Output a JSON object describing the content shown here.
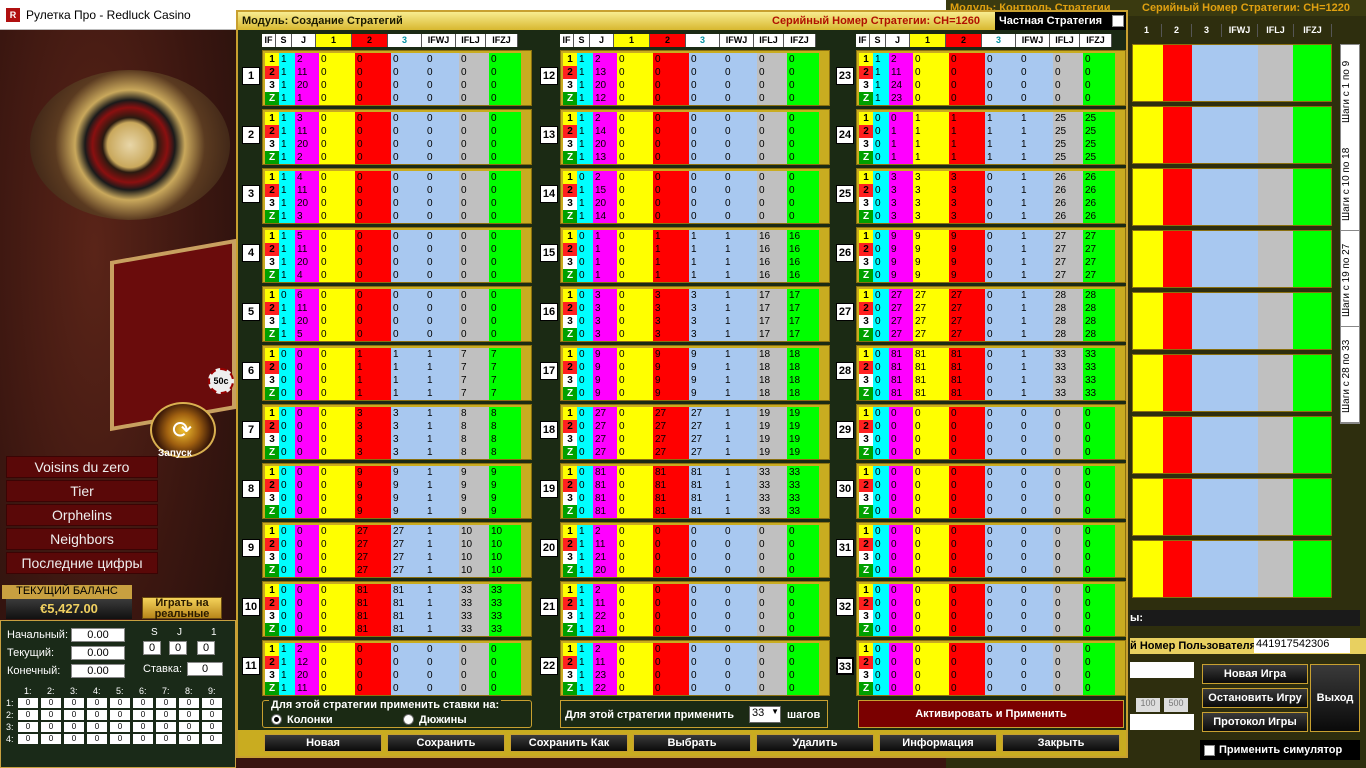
{
  "window": {
    "title": "Рулетка Про - Redluck Casino"
  },
  "casino": {
    "spin_label": "Запуск",
    "chip_label": "50c",
    "menu": [
      "Voisins du zero",
      "Tier",
      "Orphelins",
      "Neighbors",
      "Последние цифры"
    ],
    "balance_label": "ТЕКУЩИЙ БАЛАНС",
    "balance_value": "€5,427.00",
    "real_button": "Играть на реальные",
    "initial_label": "Начальный:",
    "initial_value": "0.00",
    "current_label": "Текущий:",
    "current_value": "0.00",
    "final_label": "Конечный:",
    "final_value": "0.00",
    "sj_headers": [
      "S",
      "J",
      "1"
    ],
    "sj_values": [
      "0",
      "0",
      "0"
    ],
    "stake_label": "Ставка:",
    "stake_value": "0",
    "grid_cols": [
      "1:",
      "2:",
      "3:",
      "4:",
      "5:",
      "6:",
      "7:",
      "8:",
      "9:"
    ],
    "grid_rows": [
      "1:",
      "2:",
      "3:",
      "4:"
    ],
    "grid_value": "0"
  },
  "right": {
    "header_left": "Модуль: Контроль Стратегии",
    "serial": "Серийный Номер Стратегии: СН=1220",
    "cols": [
      "1",
      "2",
      "3",
      "IFWJ",
      "IFLJ",
      "IFZJ"
    ],
    "tabs": [
      "Шаги с 1 по 9",
      "Шаги с 10 по 18",
      "Шаги с 19 по 27",
      "Шаги с 28 по 33"
    ],
    "user_serial_label": "й Номер Пользователя:",
    "user_serial_value": "441917542306",
    "buttons": {
      "new_game": "Новая Игра",
      "stop_game": "Остановить Игру",
      "protocol": "Протокол Игры",
      "exit": "Выход"
    },
    "amounts": [
      "100",
      "500"
    ],
    "tail_label": "ы:",
    "simulator": "Применить симулятор"
  },
  "dialog": {
    "title": "Модуль: Создание Стратегий",
    "serial": "Серийный Номер Стратегии: СН=1260",
    "private": "Частная Стратегия",
    "columns": [
      "IF",
      "S",
      "J",
      "1",
      "2",
      "3",
      "IFWJ",
      "IFLJ",
      "IFZJ"
    ],
    "apply_stakes_title": "Для этой стратегии применить ставки на:",
    "radio_columns": "Колонки",
    "radio_dozens": "Дюжины",
    "apply_label": "Для этой стратегии применить",
    "steps_value": "33",
    "steps_label": "шагов",
    "activate_button": "Активировать и Применить",
    "buttons": [
      "Новая",
      "Сохранить",
      "Сохранить Как",
      "Выбрать",
      "Удалить",
      "Информация",
      "Закрыть"
    ]
  },
  "steps": [
    {
      "n": "1",
      "s": [
        "1",
        "1",
        "1",
        "1"
      ],
      "j": [
        "2",
        "11",
        "20",
        "1"
      ],
      "v1": "0",
      "v2": "0",
      "v3": "0",
      "wj": "0",
      "lj": "0",
      "zj": "0"
    },
    {
      "n": "2",
      "s": [
        "1",
        "1",
        "1",
        "1"
      ],
      "j": [
        "3",
        "11",
        "20",
        "2"
      ],
      "v1": "0",
      "v2": "0",
      "v3": "0",
      "wj": "0",
      "lj": "0",
      "zj": "0"
    },
    {
      "n": "3",
      "s": [
        "1",
        "1",
        "1",
        "1"
      ],
      "j": [
        "4",
        "11",
        "20",
        "3"
      ],
      "v1": "0",
      "v2": "0",
      "v3": "0",
      "wj": "0",
      "lj": "0",
      "zj": "0"
    },
    {
      "n": "4",
      "s": [
        "1",
        "1",
        "1",
        "1"
      ],
      "j": [
        "5",
        "11",
        "20",
        "4"
      ],
      "v1": "0",
      "v2": "0",
      "v3": "0",
      "wj": "0",
      "lj": "0",
      "zj": "0"
    },
    {
      "n": "5",
      "s": [
        "0",
        "1",
        "1",
        "1"
      ],
      "j": [
        "6",
        "11",
        "20",
        "5"
      ],
      "v1": "0",
      "v2": "0",
      "v3": "0",
      "wj": "0",
      "lj": "0",
      "zj": "0"
    },
    {
      "n": "6",
      "s": [
        "0",
        "0",
        "0",
        "0"
      ],
      "j": [
        "0",
        "0",
        "0",
        "0"
      ],
      "v1": "0",
      "v2": "1",
      "v3": "1",
      "wj": "1",
      "lj": "7",
      "zj": "7"
    },
    {
      "n": "7",
      "s": [
        "0",
        "0",
        "0",
        "0"
      ],
      "j": [
        "0",
        "0",
        "0",
        "0"
      ],
      "v1": "0",
      "v2": "3",
      "v3": "3",
      "wj": "1",
      "lj": "8",
      "zj": "8"
    },
    {
      "n": "8",
      "s": [
        "0",
        "0",
        "0",
        "0"
      ],
      "j": [
        "0",
        "0",
        "0",
        "0"
      ],
      "v1": "0",
      "v2": "9",
      "v3": "9",
      "wj": "1",
      "lj": "9",
      "zj": "9"
    },
    {
      "n": "9",
      "s": [
        "0",
        "0",
        "0",
        "0"
      ],
      "j": [
        "0",
        "0",
        "0",
        "0"
      ],
      "v1": "0",
      "v2": "27",
      "v3": "27",
      "wj": "1",
      "lj": "10",
      "zj": "10"
    },
    {
      "n": "10",
      "s": [
        "0",
        "0",
        "0",
        "0"
      ],
      "j": [
        "0",
        "0",
        "0",
        "0"
      ],
      "v1": "0",
      "v2": "81",
      "v3": "81",
      "wj": "1",
      "lj": "33",
      "zj": "33"
    },
    {
      "n": "11",
      "s": [
        "1",
        "1",
        "1",
        "1"
      ],
      "j": [
        "2",
        "12",
        "20",
        "11"
      ],
      "v1": "0",
      "v2": "0",
      "v3": "0",
      "wj": "0",
      "lj": "0",
      "zj": "0"
    },
    {
      "n": "12",
      "s": [
        "1",
        "1",
        "1",
        "1"
      ],
      "j": [
        "2",
        "13",
        "20",
        "12"
      ],
      "v1": "0",
      "v2": "0",
      "v3": "0",
      "wj": "0",
      "lj": "0",
      "zj": "0"
    },
    {
      "n": "13",
      "s": [
        "1",
        "1",
        "1",
        "1"
      ],
      "j": [
        "2",
        "14",
        "20",
        "13"
      ],
      "v1": "0",
      "v2": "0",
      "v3": "0",
      "wj": "0",
      "lj": "0",
      "zj": "0"
    },
    {
      "n": "14",
      "s": [
        "0",
        "1",
        "1",
        "1"
      ],
      "j": [
        "2",
        "15",
        "20",
        "14"
      ],
      "v1": "0",
      "v2": "0",
      "v3": "0",
      "wj": "0",
      "lj": "0",
      "zj": "0"
    },
    {
      "n": "15",
      "s": [
        "0",
        "0",
        "0",
        "0"
      ],
      "j": [
        "1",
        "1",
        "1",
        "1"
      ],
      "v1": "0",
      "v2": "1",
      "v3": "1",
      "wj": "1",
      "lj": "16",
      "zj": "16"
    },
    {
      "n": "16",
      "s": [
        "0",
        "0",
        "0",
        "0"
      ],
      "j": [
        "3",
        "3",
        "3",
        "3"
      ],
      "v1": "0",
      "v2": "3",
      "v3": "3",
      "wj": "1",
      "lj": "17",
      "zj": "17"
    },
    {
      "n": "17",
      "s": [
        "0",
        "0",
        "0",
        "0"
      ],
      "j": [
        "9",
        "9",
        "9",
        "9"
      ],
      "v1": "0",
      "v2": "9",
      "v3": "9",
      "wj": "1",
      "lj": "18",
      "zj": "18"
    },
    {
      "n": "18",
      "s": [
        "0",
        "0",
        "0",
        "0"
      ],
      "j": [
        "27",
        "27",
        "27",
        "27"
      ],
      "v1": "0",
      "v2": "27",
      "v3": "27",
      "wj": "1",
      "lj": "19",
      "zj": "19"
    },
    {
      "n": "19",
      "s": [
        "0",
        "0",
        "0",
        "0"
      ],
      "j": [
        "81",
        "81",
        "81",
        "81"
      ],
      "v1": "0",
      "v2": "81",
      "v3": "81",
      "wj": "1",
      "lj": "33",
      "zj": "33"
    },
    {
      "n": "20",
      "s": [
        "1",
        "1",
        "1",
        "1"
      ],
      "j": [
        "2",
        "11",
        "21",
        "20"
      ],
      "v1": "0",
      "v2": "0",
      "v3": "0",
      "wj": "0",
      "lj": "0",
      "zj": "0"
    },
    {
      "n": "21",
      "s": [
        "1",
        "1",
        "1",
        "1"
      ],
      "j": [
        "2",
        "11",
        "22",
        "21"
      ],
      "v1": "0",
      "v2": "0",
      "v3": "0",
      "wj": "0",
      "lj": "0",
      "zj": "0"
    },
    {
      "n": "22",
      "s": [
        "1",
        "1",
        "1",
        "1"
      ],
      "j": [
        "2",
        "11",
        "23",
        "22"
      ],
      "v1": "0",
      "v2": "0",
      "v3": "0",
      "wj": "0",
      "lj": "0",
      "zj": "0"
    },
    {
      "n": "23",
      "s": [
        "1",
        "1",
        "1",
        "1"
      ],
      "j": [
        "2",
        "11",
        "24",
        "23"
      ],
      "v1": "0",
      "v2": "0",
      "v3": "0",
      "wj": "0",
      "lj": "0",
      "zj": "0"
    },
    {
      "n": "24",
      "s": [
        "0",
        "0",
        "0",
        "0"
      ],
      "j": [
        "0",
        "1",
        "1",
        "1"
      ],
      "v1": "1",
      "v2": "1",
      "v3": "1",
      "wj": "1",
      "lj": "25",
      "zj": "25"
    },
    {
      "n": "25",
      "s": [
        "0",
        "0",
        "0",
        "0"
      ],
      "j": [
        "3",
        "3",
        "3",
        "3"
      ],
      "v1": "3",
      "v2": "3",
      "v3": "0",
      "wj": "1",
      "lj": "26",
      "zj": "26"
    },
    {
      "n": "26",
      "s": [
        "0",
        "0",
        "0",
        "0"
      ],
      "j": [
        "9",
        "9",
        "9",
        "9"
      ],
      "v1": "9",
      "v2": "9",
      "v3": "0",
      "wj": "1",
      "lj": "27",
      "zj": "27"
    },
    {
      "n": "27",
      "s": [
        "0",
        "0",
        "0",
        "0"
      ],
      "j": [
        "27",
        "27",
        "27",
        "27"
      ],
      "v1": "27",
      "v2": "27",
      "v3": "0",
      "wj": "1",
      "lj": "28",
      "zj": "28"
    },
    {
      "n": "28",
      "s": [
        "0",
        "0",
        "0",
        "0"
      ],
      "j": [
        "81",
        "81",
        "81",
        "81"
      ],
      "v1": "81",
      "v2": "81",
      "v3": "0",
      "wj": "1",
      "lj": "33",
      "zj": "33"
    },
    {
      "n": "29",
      "s": [
        "0",
        "0",
        "0",
        "0"
      ],
      "j": [
        "0",
        "0",
        "0",
        "0"
      ],
      "v1": "0",
      "v2": "0",
      "v3": "0",
      "wj": "0",
      "lj": "0",
      "zj": "0"
    },
    {
      "n": "30",
      "s": [
        "0",
        "0",
        "0",
        "0"
      ],
      "j": [
        "0",
        "0",
        "0",
        "0"
      ],
      "v1": "0",
      "v2": "0",
      "v3": "0",
      "wj": "0",
      "lj": "0",
      "zj": "0"
    },
    {
      "n": "31",
      "s": [
        "0",
        "0",
        "0",
        "0"
      ],
      "j": [
        "0",
        "0",
        "0",
        "0"
      ],
      "v1": "0",
      "v2": "0",
      "v3": "0",
      "wj": "0",
      "lj": "0",
      "zj": "0"
    },
    {
      "n": "32",
      "s": [
        "0",
        "0",
        "0",
        "0"
      ],
      "j": [
        "0",
        "0",
        "0",
        "0"
      ],
      "v1": "0",
      "v2": "0",
      "v3": "0",
      "wj": "0",
      "lj": "0",
      "zj": "0"
    },
    {
      "n": "33",
      "s": [
        "0",
        "0",
        "0",
        "0"
      ],
      "j": [
        "0",
        "0",
        "0",
        "0"
      ],
      "v1": "0",
      "v2": "0",
      "v3": "0",
      "wj": "0",
      "lj": "0",
      "zj": "0"
    }
  ],
  "if_labels": [
    "1",
    "2",
    "3",
    "Z"
  ],
  "colors": {
    "gold": "#c9ac20",
    "yellow": "#ffff00",
    "red": "#ff0000",
    "cyan": "#00ffff",
    "magenta": "#ff00ff",
    "lightblue": "#a8c8f0",
    "gray": "#c0c0c0",
    "green": "#00ff00",
    "pink": "#ffc0cb",
    "if1": "#ffff00",
    "if2": "#ff2020",
    "if3": "#ffffff",
    "ifz": "#00a000"
  }
}
